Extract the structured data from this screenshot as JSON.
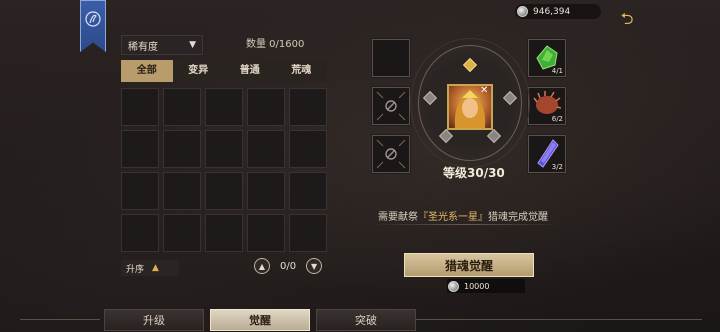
{
  "currency": {
    "icon": "silver-coin-icon",
    "amount": "946,394"
  },
  "back_icon": "return-arrow-icon",
  "filter": {
    "rarity_label": "稀有度",
    "count_label": "数量 0/1600"
  },
  "tabs": [
    "全部",
    "变异",
    "普通",
    "荒魂"
  ],
  "sort": {
    "label": "升序"
  },
  "pager": {
    "page": "0/0"
  },
  "materials": [
    {
      "icon": "green-gem-icon",
      "count": "4/1"
    },
    {
      "icon": "red-fur-icon",
      "count": "6/2"
    },
    {
      "icon": "blue-crystal-icon",
      "count": "3/2"
    }
  ],
  "hero": {
    "level": "等级30/30"
  },
  "requirement": {
    "prefix": "需要献祭",
    "highlight": "『圣光系一星』",
    "suffix": "猎魂完成觉醒"
  },
  "awaken_button": {
    "label": "猎魂觉醒"
  },
  "cost": {
    "amount": "10000"
  },
  "bottom_tabs": [
    "升级",
    "觉醒",
    "突破"
  ]
}
